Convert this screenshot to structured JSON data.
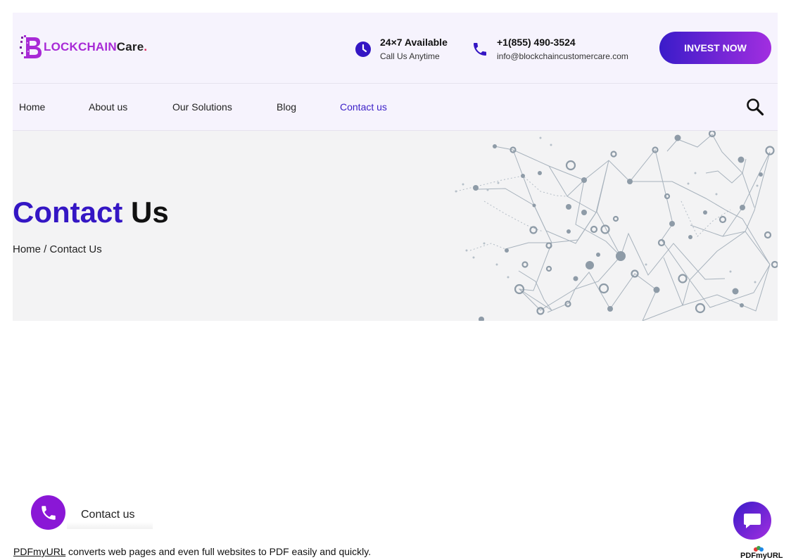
{
  "brand": {
    "part1": "LOCKCHAIN",
    "part2": "Care",
    "dot": ".",
    "accent": "#a82ad6"
  },
  "header": {
    "availability": {
      "title": "24×7 Available",
      "subtitle": "Call Us Anytime",
      "icon": "clock-icon"
    },
    "contact": {
      "phone": "+1(855) 490-3524",
      "email": "info@blockchaincustomercare.com",
      "icon": "phone-icon"
    },
    "cta_label": "INVEST NOW"
  },
  "nav": {
    "items": [
      {
        "label": "Home"
      },
      {
        "label": "About us"
      },
      {
        "label": "Our Solutions"
      },
      {
        "label": "Blog"
      },
      {
        "label": "Contact us",
        "active": true
      }
    ],
    "search_icon": "search-icon"
  },
  "hero": {
    "title_part1": "Contact",
    "title_part2": "Us",
    "breadcrumb": "Home / Contact Us"
  },
  "floating": {
    "call_label": "Contact us",
    "call_icon": "phone-icon",
    "chat_icon": "chat-icon"
  },
  "footer": {
    "link_text": "PDFmyURL",
    "note": "converts web pages and even full websites to PDF easily and quickly.",
    "badge": "PDFmyURL"
  },
  "colors": {
    "primary": "#3416c4",
    "purple": "#8a17d6",
    "header_bg": "#f6f3fd",
    "hero_bg": "#f3f3f4"
  }
}
